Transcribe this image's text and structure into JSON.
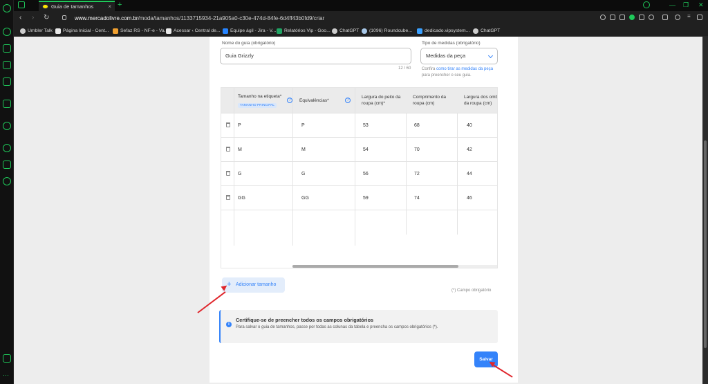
{
  "browser": {
    "tab_title": "Guia de tamanhos",
    "tab_close": "×",
    "new_tab": "+",
    "url_host": "www.mercadolivre.com.br",
    "url_path": "/moda/tamanhos/1133715934-21a905a0-c30e-474d-84fe-6d4ff43b0fd9/criar",
    "nav_back": "‹",
    "nav_forward": "›",
    "nav_reload": "↻"
  },
  "bookmarks": [
    {
      "label": "Umbler Talk",
      "color": "#cccccc"
    },
    {
      "label": "Página Inicial - Cent...",
      "color": "#e8e8e8"
    },
    {
      "label": "Sefaz RS - NF-e - Va...",
      "color": "#f0a030"
    },
    {
      "label": "Acessar ‹ Central de...",
      "color": "#e8e8e8"
    },
    {
      "label": "Equipe ágil - Jira - V...",
      "color": "#2684ff"
    },
    {
      "label": "Relatórios Vip - Goo...",
      "color": "#1fa463"
    },
    {
      "label": "ChatGPT",
      "color": "#cccccc"
    },
    {
      "label": "(1096) Roundcube...",
      "color": "#a8c8e8"
    },
    {
      "label": "dedicado.vipsystem...",
      "color": "#3aa0ff"
    },
    {
      "label": "ChatGPT",
      "color": "#cccccc"
    }
  ],
  "form": {
    "name_label": "Nome do guia (obrigatório)",
    "name_value": "Guia Grizzly",
    "name_counter": "12 / 60",
    "measure_label": "Tipo de medidas (obrigatório)",
    "measure_value": "Medidas da peça",
    "help_prefix": "Confira ",
    "help_link": "como tirar as medidas da peça",
    "help_suffix": "para preencher o seu guia."
  },
  "table": {
    "col_size": "Tamanho na etiqueta*",
    "badge": "TAMANHO PRINCIPAL",
    "col_equiv": "Equivalências*",
    "col_chest": "Largura do peito da roupa (cm)*",
    "col_length": "Comprimento da roupa (cm)",
    "col_shoulder": "Largura dos ombros da roupa (cm)",
    "help_glyph": "?",
    "rows": [
      {
        "size": "P",
        "equiv": "P",
        "chest": "53",
        "length": "68",
        "shoulder": "40"
      },
      {
        "size": "M",
        "equiv": "M",
        "chest": "54",
        "length": "70",
        "shoulder": "42"
      },
      {
        "size": "G",
        "equiv": "G",
        "chest": "56",
        "length": "72",
        "shoulder": "44"
      },
      {
        "size": "GG",
        "equiv": "GG",
        "chest": "59",
        "length": "74",
        "shoulder": "46"
      }
    ]
  },
  "actions": {
    "add_size": "Adicionar tamanho",
    "add_plus": "+",
    "required_note": "(*) Campo obrigatório",
    "save": "Salvar"
  },
  "notice": {
    "icon": "i",
    "title": "Certifique-se de preencher todos os campos obrigatórios",
    "body": "Para salvar o guia de tamanhos, passe por todas as colunas da tabela e preencha os campos obrigatórios (*)."
  },
  "colors": {
    "accent": "#3483fa",
    "browser_accent": "#1fc95a",
    "annotation_arrow": "#e0252b"
  }
}
